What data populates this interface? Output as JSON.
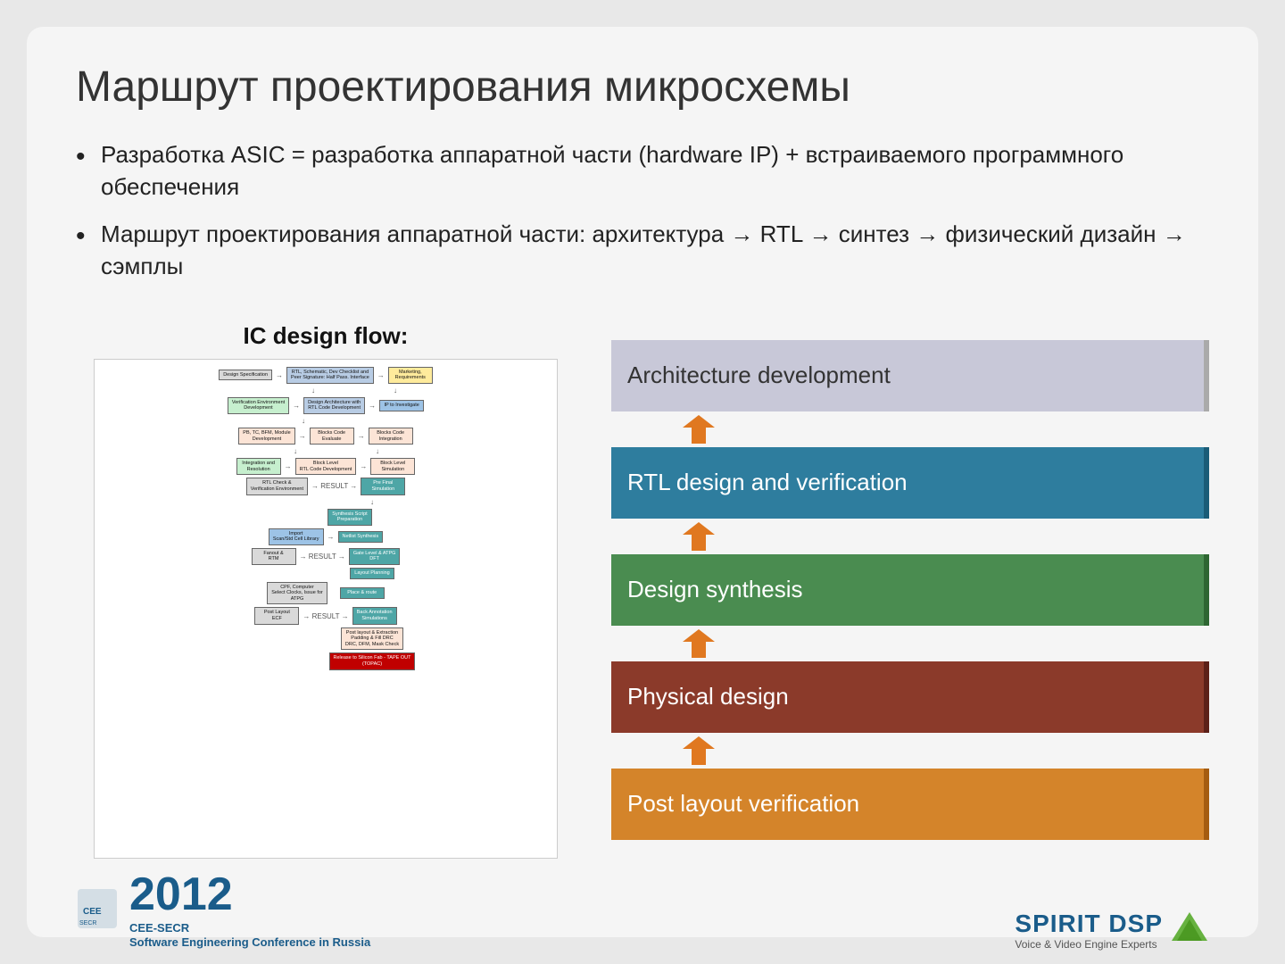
{
  "slide": {
    "title": "Маршрут проектирования микросхемы",
    "bullets": [
      "Разработка ASIC = разработка аппаратной части (hardware IP) + встраиваемого программного обеспечения",
      "Маршрут проектирования аппаратной части: архитектура → RTL → синтез → физический дизайн → сэмплы"
    ],
    "left": {
      "ic_title": "IC design flow:"
    },
    "right": {
      "boxes": [
        {
          "id": "arch",
          "label": "Architecture development",
          "class": "arch"
        },
        {
          "id": "rtl",
          "label": "RTL design and verification",
          "class": "rtl"
        },
        {
          "id": "synthesis",
          "label": "Design synthesis",
          "class": "synthesis"
        },
        {
          "id": "physical",
          "label": "Physical design",
          "class": "physical"
        },
        {
          "id": "postlayout",
          "label": "Post layout verification",
          "class": "postlayout"
        }
      ]
    },
    "footer": {
      "year": "2012",
      "org": "CEE-SECR",
      "org_sub": "Software Engineering\nConference in Russia",
      "logo_right_name": "SPIRIT DSP",
      "logo_right_sub": "Voice & Video Engine Experts"
    }
  }
}
